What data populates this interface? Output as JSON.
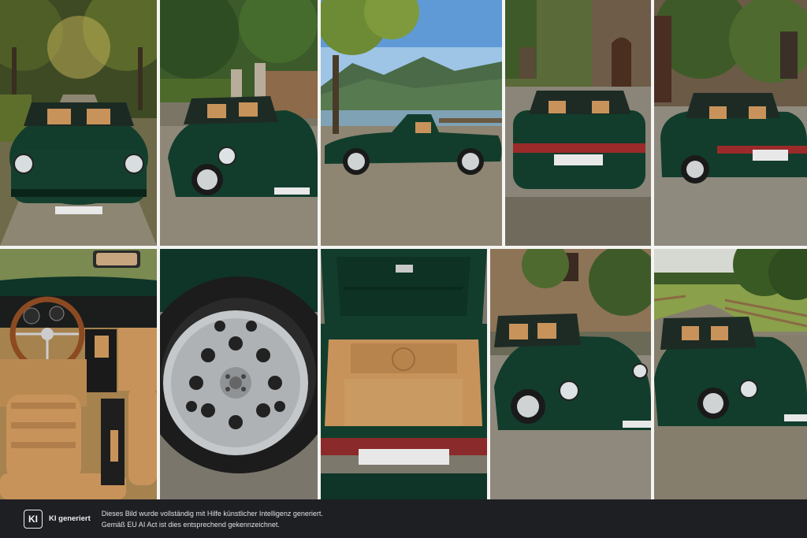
{
  "footer": {
    "badge_text": "KI",
    "badge_label": "KI generiert",
    "notice_line1": "Dieses Bild wurde vollständig mit Hilfe künstlicher Intelligenz generiert.",
    "notice_line2": "Gemäß EU AI Act ist dies entsprechend gekennzeichnet."
  },
  "photos": [
    {
      "subject": "car-front-tree-avenue"
    },
    {
      "subject": "car-front-three-quarter-gate"
    },
    {
      "subject": "car-side-lake-mountains"
    },
    {
      "subject": "car-rear-cobblestone-courtyard"
    },
    {
      "subject": "car-rear-three-quarter-ivy-house"
    },
    {
      "subject": "interior-dashboard-seats"
    },
    {
      "subject": "wheel-yokohama-tire"
    },
    {
      "subject": "open-trunk"
    },
    {
      "subject": "car-front-stone-house"
    },
    {
      "subject": "car-three-quarter-countryside-fence"
    }
  ],
  "colors": {
    "car_green": "#123d2c",
    "car_green_highlight": "#2c6a50",
    "leather_tan": "#c8935a",
    "footer_bg": "#1e1f23"
  }
}
